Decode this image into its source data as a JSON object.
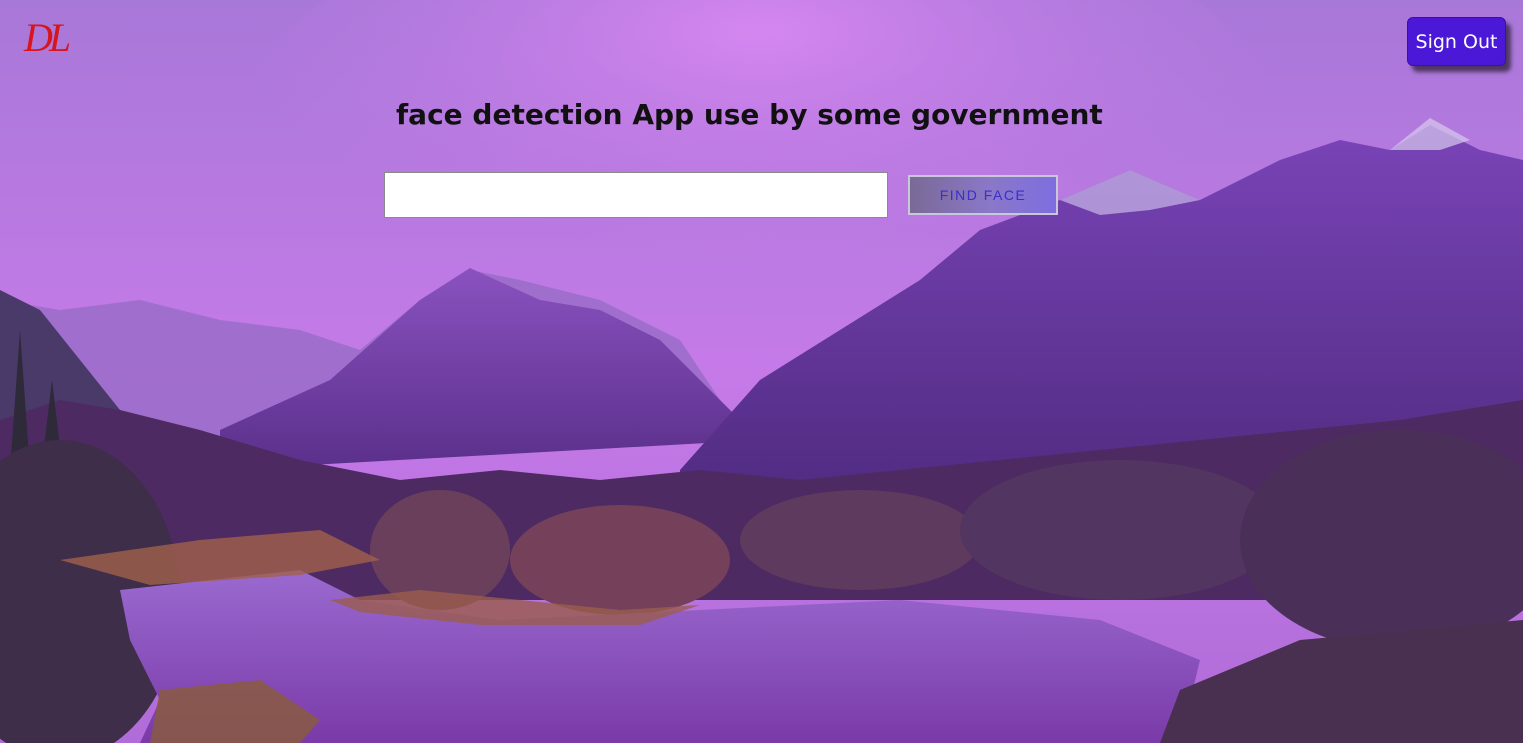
{
  "brand": {
    "logo_text": "DL",
    "logo_color": "#d8141c"
  },
  "header": {
    "sign_out_label": "Sign Out",
    "sign_out_color": "#4a18d6"
  },
  "main": {
    "title": "face detection App use by some government",
    "url_input": {
      "value": "",
      "placeholder": ""
    },
    "find_face_label": "FIND FACE"
  },
  "background": {
    "scene": "purple-tinted mountain lake landscape"
  }
}
